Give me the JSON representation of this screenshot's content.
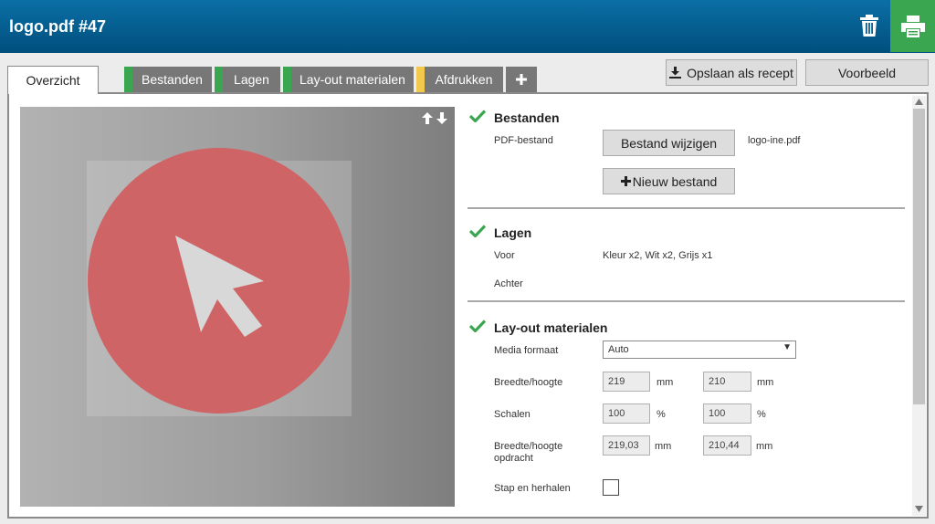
{
  "header": {
    "title": "logo.pdf #47",
    "delete_icon": "trash-icon",
    "print_icon": "printer-icon",
    "print_color": "#3aa64f"
  },
  "tabs": {
    "active": "Overzicht",
    "items": [
      {
        "label": "Bestanden",
        "status_color": "#3aa64f"
      },
      {
        "label": "Lagen",
        "status_color": "#3aa64f"
      },
      {
        "label": "Lay-out materialen",
        "status_color": "#3aa64f"
      },
      {
        "label": "Afdrukken",
        "status_color": "#f2c94c"
      }
    ],
    "add_icon": "plus-icon"
  },
  "actions": {
    "save_recipe": "Opslaan als recept",
    "save_icon": "download-icon",
    "preview": "Voorbeeld"
  },
  "preview": {
    "flip_up_icon": "arrow-up-icon",
    "flip_down_icon": "arrow-down-icon",
    "logo_color": "#cf6466"
  },
  "bestanden": {
    "title": "Bestanden",
    "pdf_label": "PDF-bestand",
    "change_button": "Bestand wijzigen",
    "filename": "logo-ine.pdf",
    "new_button": "Nieuw bestand"
  },
  "lagen": {
    "title": "Lagen",
    "front_label": "Voor",
    "front_value": "Kleur x2, Wit x2, Grijs x1",
    "back_label": "Achter"
  },
  "layout": {
    "title": "Lay-out materialen",
    "media_label": "Media formaat",
    "media_value": "Auto",
    "size_label": "Breedte/hoogte",
    "width": "219",
    "height": "210",
    "size_unit": "mm",
    "scale_label": "Schalen",
    "scale_x": "100",
    "scale_y": "100",
    "scale_unit": "%",
    "job_size_label_1": "Breedte/hoogte",
    "job_size_label_2": "opdracht",
    "job_width": "219,03",
    "job_height": "210,44",
    "job_unit": "mm",
    "step_label": "Stap en herhalen"
  }
}
